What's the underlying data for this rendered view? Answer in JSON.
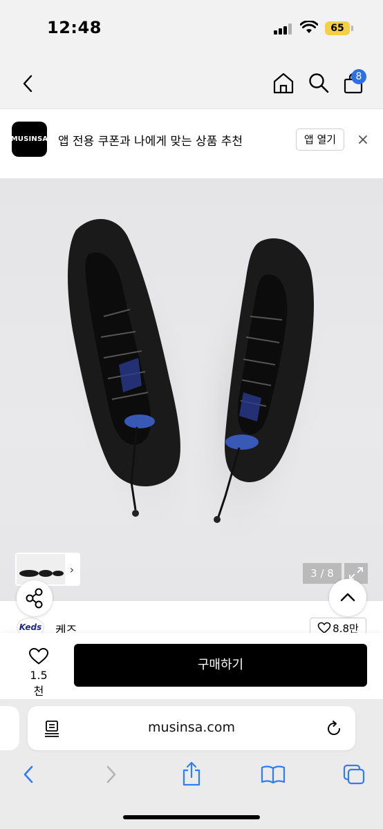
{
  "status": {
    "time": "12:48",
    "battery": "65"
  },
  "header": {
    "cart_count": "8"
  },
  "banner": {
    "logo_text": "MUSINSA",
    "text": "앱 전용 쿠폰과 나에게 맞는 상품 추천",
    "open_label": "앱 열기",
    "close": "×"
  },
  "gallery": {
    "counter": "3 / 8",
    "thumb_chevron": "›"
  },
  "brand": {
    "logo_text": "Keds",
    "name": "케즈",
    "likes": "8.8만"
  },
  "purchase": {
    "wish_count": "1.5천",
    "buy_label": "구매하기"
  },
  "browser": {
    "url": "musinsa.com"
  },
  "colors": {
    "accent_badge": "#2f6fe4",
    "buy_button": "#000000",
    "battery": "#f7cf46",
    "ios_blue": "#2f7cf6"
  }
}
